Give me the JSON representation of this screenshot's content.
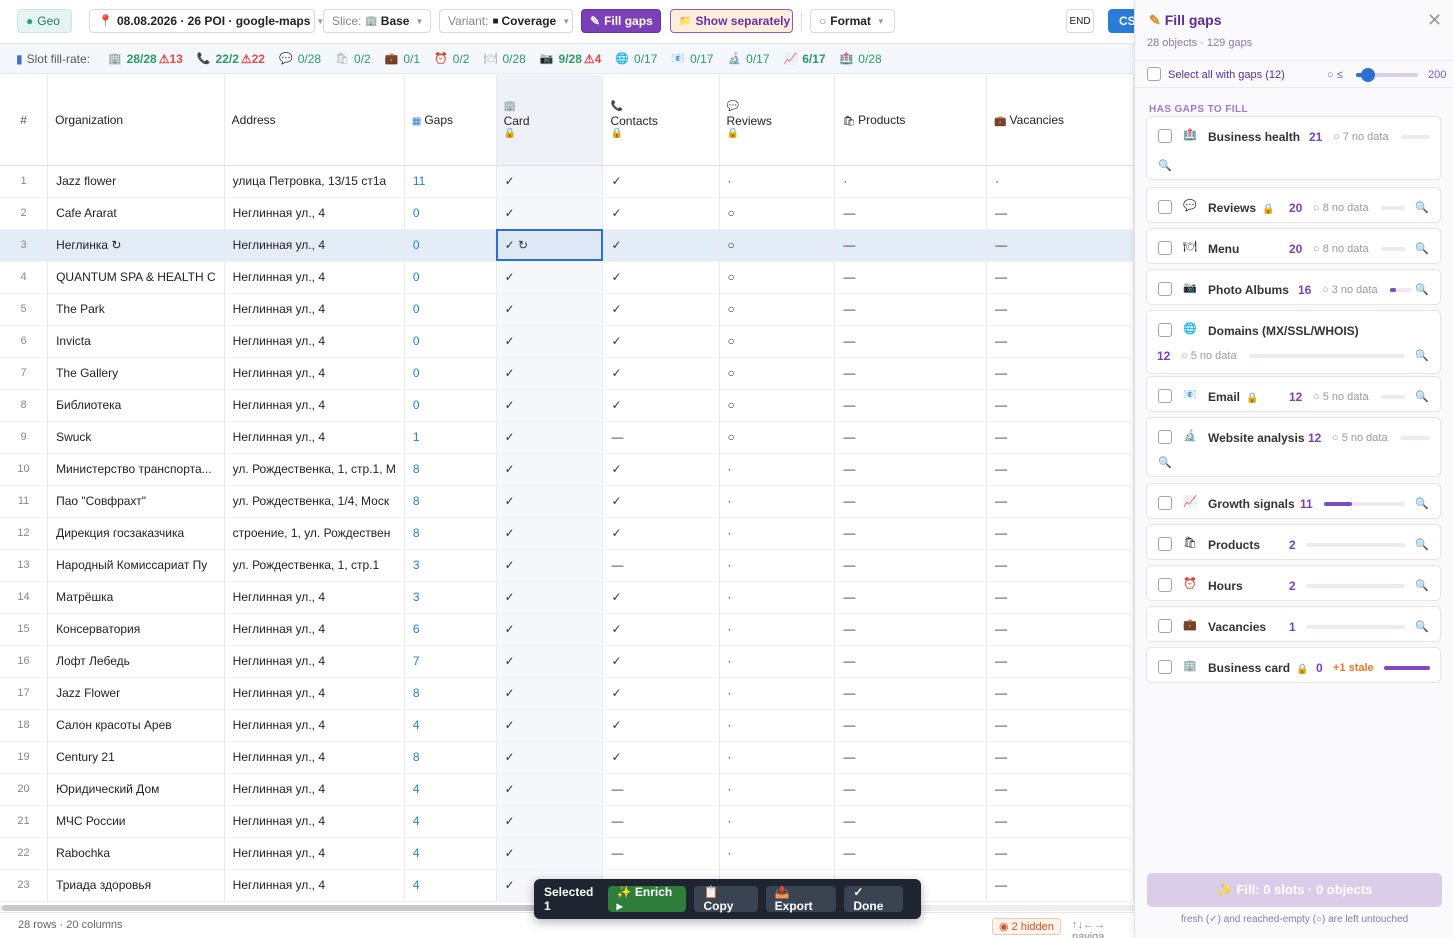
{
  "toolbar": {
    "geo": "Geo",
    "dataset": "08.08.2026 · 26 POI · google-maps",
    "slice_label": "Slice:",
    "slice_value": "Base",
    "variant_label": "Variant:",
    "variant_value": "Coverage",
    "fill_gaps": "Fill gaps",
    "show_separately": "Show separately",
    "format": "Format",
    "end": "END",
    "cs": "CS"
  },
  "fill_rate": {
    "label": "Slot fill-rate:",
    "items": [
      {
        "icon": "🏢",
        "value": "28/28",
        "warn": "⚠13"
      },
      {
        "icon": "📞",
        "value": "22/2",
        "warn": "⚠22"
      },
      {
        "icon": "💬",
        "value": "0/28",
        "warn": ""
      },
      {
        "icon": "🛍",
        "value": "0/2",
        "warn": ""
      },
      {
        "icon": "💼",
        "value": "0/1",
        "warn": ""
      },
      {
        "icon": "⏰",
        "value": "0/2",
        "warn": ""
      },
      {
        "icon": "🍽",
        "value": "0/28",
        "warn": ""
      },
      {
        "icon": "📷",
        "value": "9/28",
        "warn": "⚠4"
      },
      {
        "icon": "🌐",
        "value": "0/17",
        "warn": ""
      },
      {
        "icon": "📧",
        "value": "0/17",
        "warn": ""
      },
      {
        "icon": "🔬",
        "value": "0/17",
        "warn": ""
      },
      {
        "icon": "📈",
        "value": "6/17",
        "warn": ""
      },
      {
        "icon": "🏥",
        "value": "0/28",
        "warn": ""
      }
    ]
  },
  "table": {
    "headers": {
      "num": "#",
      "org": "Organization",
      "address": "Address",
      "gaps": "Gaps",
      "card": "Card",
      "contacts": "Contacts",
      "reviews": "Reviews",
      "products": "Products",
      "vacancies": "Vacancies"
    },
    "rows": [
      {
        "n": "1",
        "org": "Jazz flower",
        "addr": "улица Петровка, 13/15 ст1а",
        "gaps": "11",
        "card": "✓",
        "contacts": "✓",
        "reviews": "·",
        "products": "·",
        "vacancies": "·"
      },
      {
        "n": "2",
        "org": "Cafe Ararat",
        "addr": "Неглинная ул., 4",
        "gaps": "0",
        "card": "✓",
        "contacts": "✓",
        "reviews": "○",
        "products": "—",
        "vacancies": "—"
      },
      {
        "n": "3",
        "org": "Неглинка ↻",
        "addr": "Неглинная ул., 4",
        "gaps": "0",
        "card": "✓ ↻",
        "contacts": "✓",
        "reviews": "○",
        "products": "—",
        "vacancies": "—"
      },
      {
        "n": "4",
        "org": "QUANTUM SPA & HEALTH C",
        "addr": "Неглинная ул., 4",
        "gaps": "0",
        "card": "✓",
        "contacts": "✓",
        "reviews": "○",
        "products": "—",
        "vacancies": "—"
      },
      {
        "n": "5",
        "org": "The Park",
        "addr": "Неглинная ул., 4",
        "gaps": "0",
        "card": "✓",
        "contacts": "✓",
        "reviews": "○",
        "products": "—",
        "vacancies": "—"
      },
      {
        "n": "6",
        "org": "Invicta",
        "addr": "Неглинная ул., 4",
        "gaps": "0",
        "card": "✓",
        "contacts": "✓",
        "reviews": "○",
        "products": "—",
        "vacancies": "—"
      },
      {
        "n": "7",
        "org": "The Gallery",
        "addr": "Неглинная ул., 4",
        "gaps": "0",
        "card": "✓",
        "contacts": "✓",
        "reviews": "○",
        "products": "—",
        "vacancies": "—"
      },
      {
        "n": "8",
        "org": "Библиотека",
        "addr": "Неглинная ул., 4",
        "gaps": "0",
        "card": "✓",
        "contacts": "✓",
        "reviews": "○",
        "products": "—",
        "vacancies": "—"
      },
      {
        "n": "9",
        "org": "Swuck",
        "addr": "Неглинная ул., 4",
        "gaps": "1",
        "card": "✓",
        "contacts": "—",
        "reviews": "○",
        "products": "—",
        "vacancies": "—"
      },
      {
        "n": "10",
        "org": "Министерство транспорта...",
        "addr": "ул. Рождественка, 1, стр.1, М",
        "gaps": "8",
        "card": "✓",
        "contacts": "✓",
        "reviews": "·",
        "products": "—",
        "vacancies": "—"
      },
      {
        "n": "11",
        "org": "Пао \"Совфрахт\"",
        "addr": "ул. Рождественка, 1/4, Моск",
        "gaps": "8",
        "card": "✓",
        "contacts": "✓",
        "reviews": "·",
        "products": "—",
        "vacancies": "—"
      },
      {
        "n": "12",
        "org": "Дирекция госзаказчика",
        "addr": "строение, 1, ул. Рождествен",
        "gaps": "8",
        "card": "✓",
        "contacts": "✓",
        "reviews": "·",
        "products": "—",
        "vacancies": "—"
      },
      {
        "n": "13",
        "org": "Народный Комиссариат Пу",
        "addr": "ул. Рождественка, 1, стр.1",
        "gaps": "3",
        "card": "✓",
        "contacts": "—",
        "reviews": "·",
        "products": "—",
        "vacancies": "—"
      },
      {
        "n": "14",
        "org": "Матрёшка",
        "addr": "Неглинная ул., 4",
        "gaps": "3",
        "card": "✓",
        "contacts": "✓",
        "reviews": "·",
        "products": "—",
        "vacancies": "—"
      },
      {
        "n": "15",
        "org": "Консерватория",
        "addr": "Неглинная ул., 4",
        "gaps": "6",
        "card": "✓",
        "contacts": "✓",
        "reviews": "·",
        "products": "—",
        "vacancies": "—"
      },
      {
        "n": "16",
        "org": "Лофт Лебедь",
        "addr": "Неглинная ул., 4",
        "gaps": "7",
        "card": "✓",
        "contacts": "✓",
        "reviews": "·",
        "products": "—",
        "vacancies": "—"
      },
      {
        "n": "17",
        "org": "Jazz Flower",
        "addr": "Неглинная ул., 4",
        "gaps": "8",
        "card": "✓",
        "contacts": "✓",
        "reviews": "·",
        "products": "—",
        "vacancies": "—"
      },
      {
        "n": "18",
        "org": "Салон красоты Арев",
        "addr": "Неглинная ул., 4",
        "gaps": "4",
        "card": "✓",
        "contacts": "✓",
        "reviews": "·",
        "products": "—",
        "vacancies": "—"
      },
      {
        "n": "19",
        "org": "Century 21",
        "addr": "Неглинная ул., 4",
        "gaps": "8",
        "card": "✓",
        "contacts": "✓",
        "reviews": "·",
        "products": "—",
        "vacancies": "—"
      },
      {
        "n": "20",
        "org": "Юридический Дом",
        "addr": "Неглинная ул., 4",
        "gaps": "4",
        "card": "✓",
        "contacts": "—",
        "reviews": "·",
        "products": "—",
        "vacancies": "—"
      },
      {
        "n": "21",
        "org": "МЧС России",
        "addr": "Неглинная ул., 4",
        "gaps": "4",
        "card": "✓",
        "contacts": "—",
        "reviews": "·",
        "products": "—",
        "vacancies": "—"
      },
      {
        "n": "22",
        "org": "Rabochka",
        "addr": "Неглинная ул., 4",
        "gaps": "4",
        "card": "✓",
        "contacts": "—",
        "reviews": "·",
        "products": "—",
        "vacancies": "—"
      },
      {
        "n": "23",
        "org": "Триада здоровья",
        "addr": "Неглинная ул., 4",
        "gaps": "4",
        "card": "✓",
        "contacts": "",
        "reviews": "",
        "products": "",
        "vacancies": "—"
      }
    ],
    "selected_row": 2
  },
  "footer": {
    "rows": "28 rows · 20 columns",
    "hidden": "2 hidden",
    "nav": "↑↓←→ naviga"
  },
  "selection_bar": {
    "label": "Selected 1",
    "enrich": "✨ Enrich ▸",
    "copy": "📋 Copy",
    "export": "📤 Export",
    "done": "✓ Done"
  },
  "panel": {
    "title": "Fill gaps",
    "subtitle": "28 objects · 129 gaps",
    "select_all": "Select all with gaps (12)",
    "threshold_label": "○ ≤",
    "threshold_max": "200",
    "threshold_fraction": 0.2,
    "section": "HAS GAPS TO FILL",
    "items": [
      {
        "name": "Business health",
        "icon": "🏥",
        "count": "21",
        "nodata": "○ 7 no data",
        "fill": 0.0
      },
      {
        "name": "Reviews",
        "icon": "💬",
        "count": "20",
        "nodata": "○ 8 no data",
        "fill": 0.0
      },
      {
        "name": "Menu",
        "icon": "🍽",
        "count": "20",
        "nodata": "○ 8 no data",
        "fill": 0.0
      },
      {
        "name": "Photo Albums",
        "icon": "📷",
        "count": "16",
        "nodata": "○ 3 no data",
        "fill": 0.3
      },
      {
        "name": "Domains (MX/SSL/WHOIS)",
        "icon": "🌐",
        "count": "12",
        "nodata": "○ 5 no data",
        "fill": 0.0
      },
      {
        "name": "Email",
        "icon": "📧",
        "count": "12",
        "nodata": "○ 5 no data",
        "fill": 0.0
      },
      {
        "name": "Website analysis",
        "icon": "🔬",
        "count": "12",
        "nodata": "○ 5 no data",
        "fill": 0.0
      },
      {
        "name": "Growth signals",
        "icon": "📈",
        "count": "11",
        "nodata": "",
        "fill": 0.35
      },
      {
        "name": "Products",
        "icon": "🛍",
        "count": "2",
        "nodata": "",
        "fill": 0.0
      },
      {
        "name": "Hours",
        "icon": "⏰",
        "count": "2",
        "nodata": "",
        "fill": 0.0
      },
      {
        "name": "Vacancies",
        "icon": "💼",
        "count": "1",
        "nodata": "",
        "fill": 0.0
      },
      {
        "name": "Business card",
        "icon": "🏢",
        "count": "0",
        "nodata": "+1 stale",
        "fill": 1.0
      }
    ],
    "fill_button": "✨ Fill: 0 slots · 0 objects",
    "note": "fresh (✓) and reached-empty (○) are left untouched"
  }
}
